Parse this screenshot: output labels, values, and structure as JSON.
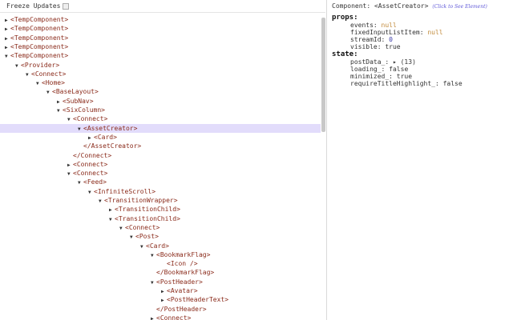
{
  "toolbar": {
    "freeze_label": "Freeze Updates"
  },
  "tree": [
    {
      "indent": 0,
      "arrow": "▶",
      "tag": "<TempComponent>"
    },
    {
      "indent": 0,
      "arrow": "▶",
      "tag": "<TempComponent>"
    },
    {
      "indent": 0,
      "arrow": "▶",
      "tag": "<TempComponent>"
    },
    {
      "indent": 0,
      "arrow": "▶",
      "tag": "<TempComponent>"
    },
    {
      "indent": 0,
      "arrow": "▼",
      "tag": "<TempComponent>"
    },
    {
      "indent": 1,
      "arrow": "▼",
      "tag": "<Provider>"
    },
    {
      "indent": 2,
      "arrow": "▼",
      "tag": "<Connect>"
    },
    {
      "indent": 3,
      "arrow": "▼",
      "tag": "<Home>"
    },
    {
      "indent": 4,
      "arrow": "▼",
      "tag": "<BaseLayout>"
    },
    {
      "indent": 5,
      "arrow": "▶",
      "tag": "<SubNav>"
    },
    {
      "indent": 5,
      "arrow": "▼",
      "tag": "<SixColumn>"
    },
    {
      "indent": 6,
      "arrow": "▼",
      "tag": "<Connect>"
    },
    {
      "indent": 7,
      "arrow": "▼",
      "tag": "<AssetCreator>",
      "selected": true
    },
    {
      "indent": 8,
      "arrow": "▶",
      "tag": "<Card>"
    },
    {
      "indent": 7,
      "arrow": "",
      "tag": "</AssetCreator>"
    },
    {
      "indent": 6,
      "arrow": "",
      "tag": "</Connect>"
    },
    {
      "indent": 6,
      "arrow": "▶",
      "tag": "<Connect>"
    },
    {
      "indent": 6,
      "arrow": "▼",
      "tag": "<Connect>"
    },
    {
      "indent": 7,
      "arrow": "▼",
      "tag": "<Feed>"
    },
    {
      "indent": 8,
      "arrow": "▼",
      "tag": "<InfiniteScroll>"
    },
    {
      "indent": 9,
      "arrow": "▼",
      "tag": "<TransitionWrapper>"
    },
    {
      "indent": 10,
      "arrow": "▶",
      "tag": "<TransitionChild>"
    },
    {
      "indent": 10,
      "arrow": "▼",
      "tag": "<TransitionChild>"
    },
    {
      "indent": 11,
      "arrow": "▼",
      "tag": "<Connect>"
    },
    {
      "indent": 12,
      "arrow": "▼",
      "tag": "<Post>"
    },
    {
      "indent": 13,
      "arrow": "▼",
      "tag": "<Card>"
    },
    {
      "indent": 14,
      "arrow": "▼",
      "tag": "<BookmarkFlag>"
    },
    {
      "indent": 15,
      "arrow": "",
      "tag": "<Icon />"
    },
    {
      "indent": 14,
      "arrow": "",
      "tag": "</BookmarkFlag>"
    },
    {
      "indent": 14,
      "arrow": "▼",
      "tag": "<PostHeader>"
    },
    {
      "indent": 15,
      "arrow": "▶",
      "tag": "<Avatar>"
    },
    {
      "indent": 15,
      "arrow": "▶",
      "tag": "<PostHeaderText>"
    },
    {
      "indent": 14,
      "arrow": "",
      "tag": "</PostHeader>"
    },
    {
      "indent": 14,
      "arrow": "▶",
      "tag": "<Connect>"
    }
  ],
  "detail": {
    "component_prefix": "Component: ",
    "component_name": "<AssetCreator>",
    "hint": "(Click to See Element)",
    "props_label": "props:",
    "props": [
      {
        "key": "events:",
        "value": "null",
        "type": "null"
      },
      {
        "key": "fixedInputListItem:",
        "value": "null",
        "type": "null"
      },
      {
        "key": "streamId:",
        "value": "0",
        "type": "num"
      },
      {
        "key": "visible:",
        "value": "true",
        "type": "bool"
      }
    ],
    "state_label": "state:",
    "state": [
      {
        "key": "postData_:",
        "value": "▸ (13)",
        "type": "bool"
      },
      {
        "key": "loading_:",
        "value": "false",
        "type": "bool"
      },
      {
        "key": "minimized_:",
        "value": "true",
        "type": "bool"
      },
      {
        "key": "requireTitleHighlight_:",
        "value": "false",
        "type": "bool"
      }
    ]
  },
  "colors": {
    "selection": "#e2dcfb",
    "tag": "#8a2a1a",
    "null": "#c28b3c",
    "number": "#3a3aa8",
    "hint": "#5f58d8"
  }
}
